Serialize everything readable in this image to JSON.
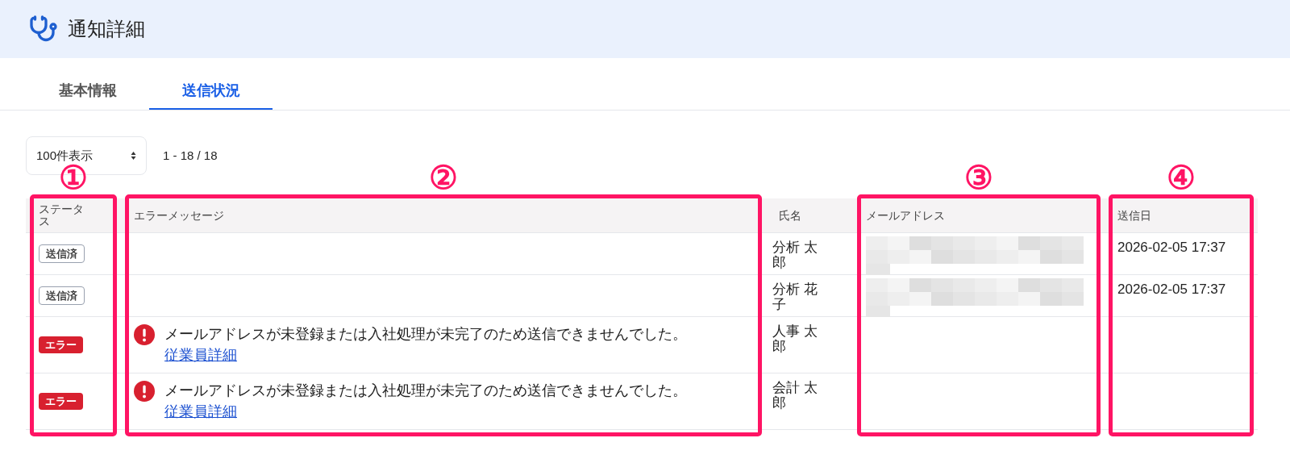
{
  "header": {
    "title": "通知詳細"
  },
  "tabs": [
    {
      "label": "基本情報",
      "selected": false
    },
    {
      "label": "送信状況",
      "selected": true
    }
  ],
  "page_size": {
    "value": "100件表示"
  },
  "range": "1 - 18 / 18",
  "table": {
    "columns": [
      {
        "label": "ステータス",
        "callout": "①"
      },
      {
        "label": "エラーメッセージ",
        "callout": "②"
      },
      {
        "label": "氏名"
      },
      {
        "label": "メールアドレス",
        "callout": "③"
      },
      {
        "label": "送信日",
        "callout": "④"
      }
    ],
    "rows": [
      {
        "status": {
          "kind": "sent",
          "label": "送信済"
        },
        "name": "分析 太郎",
        "email_redacted": true,
        "date": "2026-02-05 17:37"
      },
      {
        "status": {
          "kind": "sent",
          "label": "送信済"
        },
        "name": "分析 花子",
        "email_redacted": true,
        "date": "2026-02-05 17:37"
      },
      {
        "status": {
          "kind": "error",
          "label": "エラー"
        },
        "error": {
          "message": "メールアドレスが未登録または入社処理が未完了のため送信できませんでした。",
          "link": "従業員詳細"
        },
        "name": "人事 太郎",
        "email_redacted": false
      },
      {
        "status": {
          "kind": "error",
          "label": "エラー"
        },
        "error": {
          "message": "メールアドレスが未登録または入社処理が未完了のため送信できませんでした。",
          "link": "従業員詳細"
        },
        "name": "会計 太郎",
        "email_redacted": false
      }
    ]
  }
}
